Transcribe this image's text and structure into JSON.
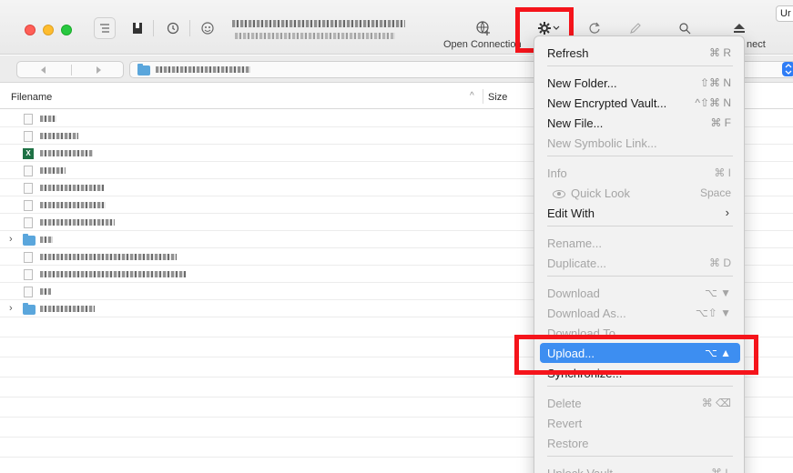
{
  "toolbar": {
    "open_connection_label": "Open Connection",
    "disconnect_label_partial": "nect",
    "upper_right_partial": "Ur"
  },
  "columns": {
    "filename": "Filename",
    "size": "Size"
  },
  "file_rows": [
    {
      "type": "file",
      "icon": "file-icon",
      "name_width": 18
    },
    {
      "type": "file",
      "icon": "file-icon",
      "name_width": 42
    },
    {
      "type": "excel",
      "icon": "excel-file-icon",
      "name_width": 58
    },
    {
      "type": "file",
      "icon": "file-icon",
      "name_width": 28
    },
    {
      "type": "file",
      "icon": "file-icon",
      "name_width": 70
    },
    {
      "type": "file",
      "icon": "file-icon",
      "name_width": 72
    },
    {
      "type": "file",
      "icon": "file-icon",
      "name_width": 82
    },
    {
      "type": "folder",
      "icon": "folder-icon",
      "name_width": 14
    },
    {
      "type": "file",
      "icon": "file-icon",
      "name_width": 150
    },
    {
      "type": "file",
      "icon": "file-icon",
      "name_width": 160
    },
    {
      "type": "file",
      "icon": "file-icon",
      "name_width": 12
    },
    {
      "type": "folder",
      "icon": "folder-icon",
      "name_width": 60
    }
  ],
  "menu": {
    "items": [
      {
        "id": "refresh",
        "label": "Refresh",
        "shortcut": "⌘ R",
        "disabled": false
      },
      {
        "id": "new-folder",
        "label": "New Folder...",
        "shortcut": "⇧⌘ N",
        "disabled": false
      },
      {
        "id": "new-encrypted-vault",
        "label": "New Encrypted Vault...",
        "shortcut": "^⇧⌘ N",
        "disabled": false
      },
      {
        "id": "new-file",
        "label": "New File...",
        "shortcut": "⌘ F",
        "disabled": false
      },
      {
        "id": "new-symbolic-link",
        "label": "New Symbolic Link...",
        "shortcut": "",
        "disabled": true
      },
      {
        "id": "info",
        "label": "Info",
        "shortcut": "⌘ I",
        "disabled": true
      },
      {
        "id": "quick-look",
        "label": "Quick Look",
        "shortcut": "Space",
        "disabled": true
      },
      {
        "id": "edit-with",
        "label": "Edit With",
        "shortcut": "",
        "disabled": false
      },
      {
        "id": "rename",
        "label": "Rename...",
        "shortcut": "",
        "disabled": true
      },
      {
        "id": "duplicate",
        "label": "Duplicate...",
        "shortcut": "⌘ D",
        "disabled": true
      },
      {
        "id": "download",
        "label": "Download",
        "shortcut": "⌥ ▼",
        "disabled": true
      },
      {
        "id": "download-as",
        "label": "Download As...",
        "shortcut": "⌥⇧ ▼",
        "disabled": true
      },
      {
        "id": "download-to",
        "label": "Download To...",
        "shortcut": "",
        "disabled": true
      },
      {
        "id": "upload",
        "label": "Upload...",
        "shortcut": "⌥ ▲",
        "disabled": false,
        "selected": true
      },
      {
        "id": "synchronize",
        "label": "Synchronize...",
        "shortcut": "",
        "disabled": false
      },
      {
        "id": "delete",
        "label": "Delete",
        "shortcut": "⌘ ⌫",
        "disabled": true
      },
      {
        "id": "revert",
        "label": "Revert",
        "shortcut": "",
        "disabled": true
      },
      {
        "id": "restore",
        "label": "Restore",
        "shortcut": "",
        "disabled": true
      },
      {
        "id": "unlock-vault",
        "label": "Unlock Vault",
        "shortcut": "⌘ L",
        "disabled": true
      }
    ]
  },
  "colors": {
    "highlight_box": "#f5141b",
    "menu_selected": "#3d8ef1",
    "folder_blue": "#5aa6dc"
  }
}
